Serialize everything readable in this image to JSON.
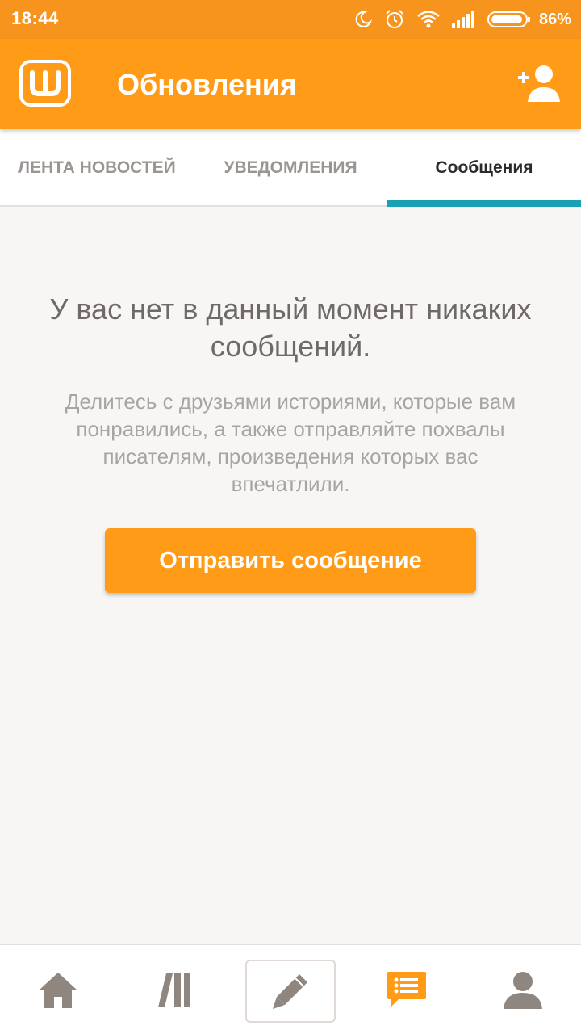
{
  "status_bar": {
    "time": "18:44",
    "battery_percent": "86%",
    "icons": [
      "moon-icon",
      "alarm-icon",
      "wifi-icon",
      "signal-icon",
      "battery-icon"
    ]
  },
  "app_bar": {
    "logo_icon": "wattpad-logo-icon",
    "title": "Обновления",
    "action_icon": "add-user-icon"
  },
  "tabs": [
    {
      "label": "ЛЕНТА НОВОСТЕЙ",
      "active": false
    },
    {
      "label": "УВЕДОМЛЕНИЯ",
      "active": false
    },
    {
      "label": "Сообщения",
      "active": true
    }
  ],
  "empty_state": {
    "title": "У вас нет в данный момент никаких сообщений.",
    "description": "Делитесь с друзьями историями, которые вам понравились, а также отправляйте похвалы писателям, произведения которых вас впечатлили.",
    "button_label": "Отправить сообщение"
  },
  "bottom_nav": {
    "items": [
      {
        "icon": "home-icon",
        "active": false
      },
      {
        "icon": "library-icon",
        "active": false
      },
      {
        "icon": "pencil-icon",
        "active": false
      },
      {
        "icon": "messages-icon",
        "active": true
      },
      {
        "icon": "profile-icon",
        "active": false
      }
    ]
  },
  "colors": {
    "brand_orange": "#ff9b16",
    "tab_indicator": "#1aa0b4",
    "icon_gray": "#8f8680",
    "active_nav": "#ff9b16"
  }
}
